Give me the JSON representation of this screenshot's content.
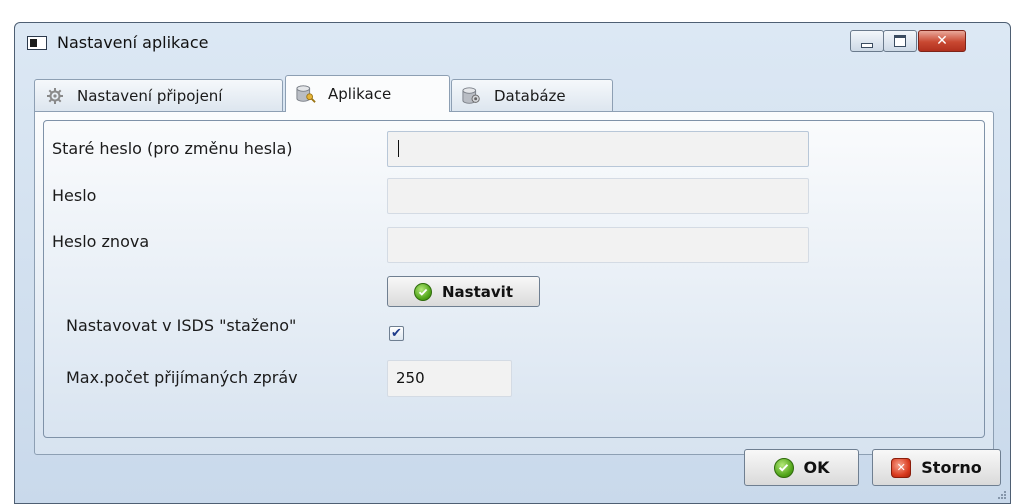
{
  "window": {
    "title": "Nastavení aplikace",
    "icons": {
      "app": "application-window-icon",
      "minimize": "minimize-icon",
      "maximize": "maximize-icon",
      "close": "close-icon"
    },
    "close_glyph": "✕"
  },
  "tabs": [
    {
      "label": "Nastavení připojení",
      "icon": "gear-icon",
      "active": false
    },
    {
      "label": "Aplikace",
      "icon": "database-key-icon",
      "active": true
    },
    {
      "label": "Databáze",
      "icon": "database-gear-icon",
      "active": false
    }
  ],
  "form": {
    "old_password": {
      "label": "Staré heslo  (pro změnu hesla)",
      "value": ""
    },
    "password": {
      "label": "Heslo",
      "value": ""
    },
    "password_again": {
      "label": "Heslo znova",
      "value": ""
    },
    "set_button": {
      "label": "Nastavit",
      "icon": "check-circle-icon"
    },
    "set_downloaded": {
      "label": "Nastavovat v ISDS \"staženo\"",
      "checked": true,
      "check_glyph": "✔"
    },
    "max_messages": {
      "label": "Max.počet přijímaných zpráv",
      "value": "250"
    }
  },
  "footer": {
    "ok_button": {
      "label": "OK",
      "icon": "check-circle-icon"
    },
    "cancel_button": {
      "label": "Storno",
      "icon": "cancel-icon"
    },
    "cancel_glyph": "✕"
  },
  "colors": {
    "window_bg": "#dce8f4",
    "accent_ok": "#4fa318",
    "accent_cancel": "#d9391d",
    "close_button": "#c84831"
  }
}
